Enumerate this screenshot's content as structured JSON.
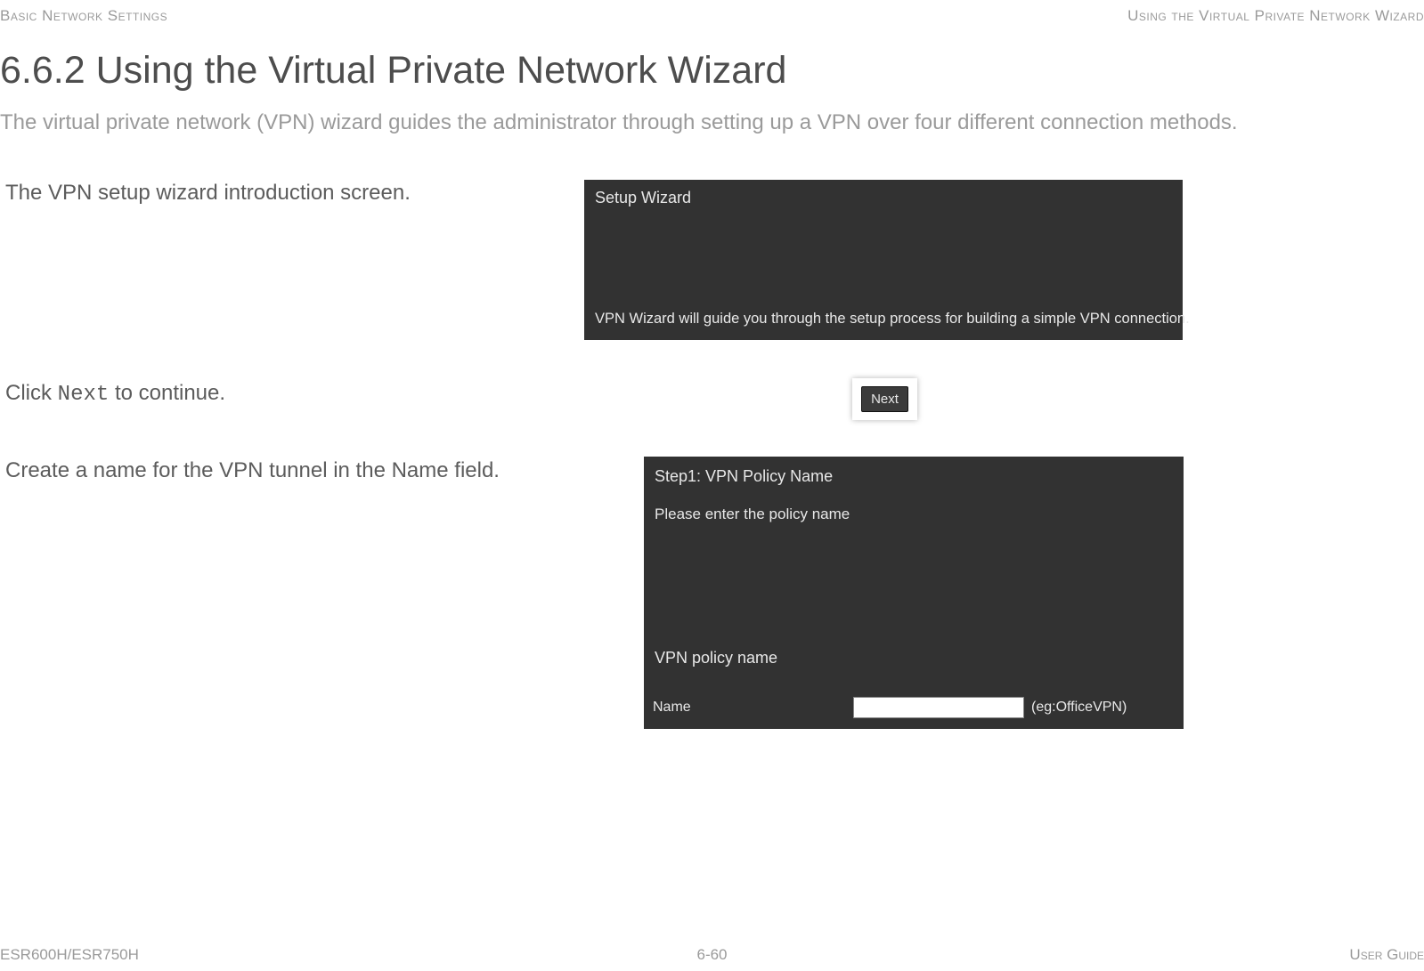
{
  "header": {
    "left": "Basic Network Settings",
    "right": "Using the Virtual Private Network Wizard"
  },
  "section": {
    "number_title": "6.6.2 Using the Virtual Private Network Wizard",
    "intro": "The virtual private network (VPN) wizard guides the administrator through setting up a VPN over four different connection methods."
  },
  "steps": {
    "s1": "The VPN setup wizard introduction screen.",
    "s2_pre": "Click ",
    "s2_code": "Next",
    "s2_post": " to continue.",
    "s3": "Create a name for the VPN tunnel in the Name field."
  },
  "panel1": {
    "title": "Setup Wizard",
    "desc": "VPN Wizard will guide you through the setup process for building a simple VPN connection."
  },
  "next_button": {
    "label": "Next"
  },
  "panel2": {
    "title": "Step1: VPN Policy Name",
    "subtitle": "Please enter the policy name",
    "section_name": "VPN policy name",
    "name_label": "Name",
    "name_value": "",
    "name_eg": "(eg:OfficeVPN)"
  },
  "footer": {
    "left": "ESR600H/ESR750H",
    "center": "6-60",
    "right": "User Guide"
  }
}
